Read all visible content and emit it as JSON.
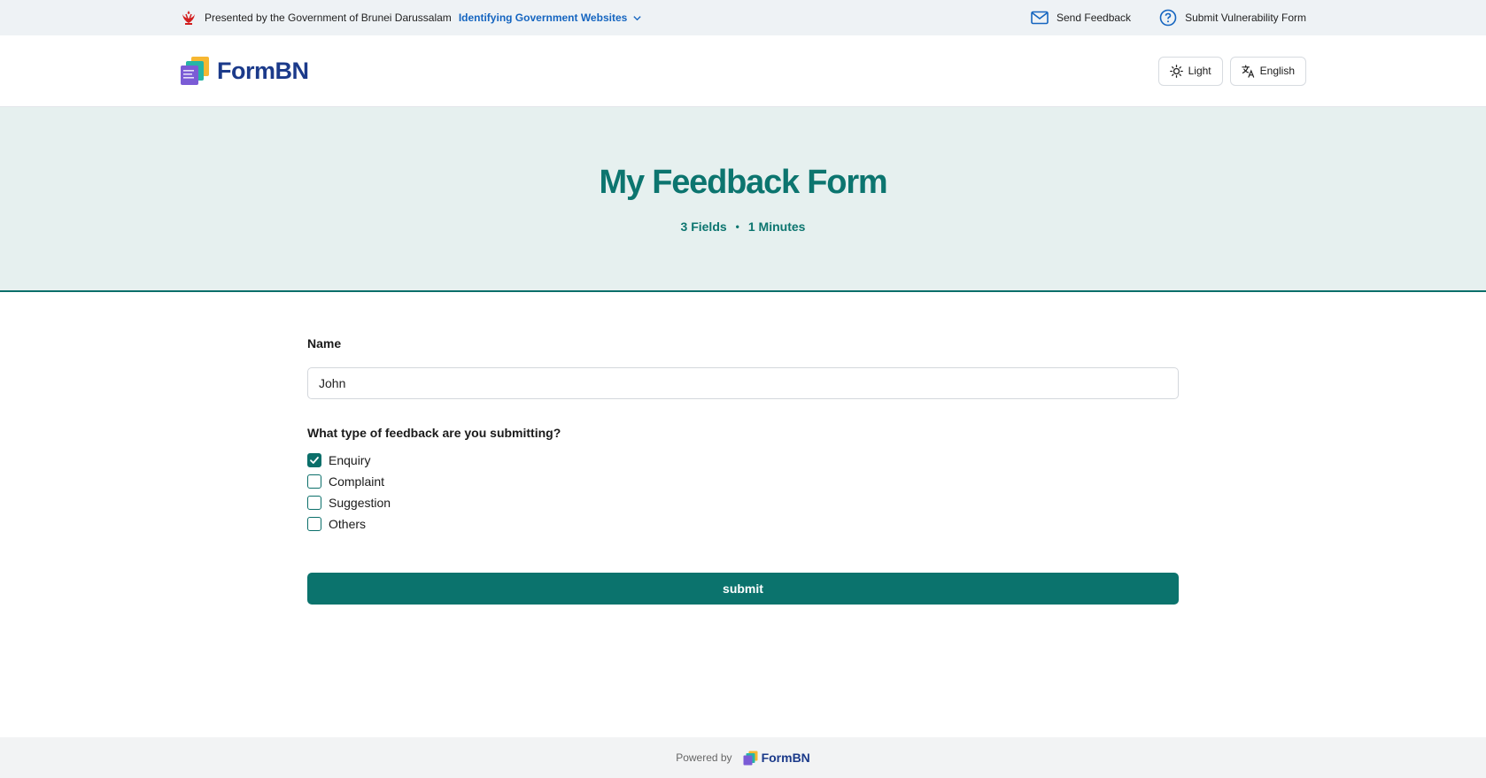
{
  "govbar": {
    "presented_text": "Presented by the Government of Brunei Darussalam",
    "identify_link": "Identifying Government Websites",
    "send_feedback": "Send Feedback",
    "submit_vulnerability": "Submit Vulnerability Form"
  },
  "header": {
    "brand": "FormBN",
    "theme_button": "Light",
    "language_button": "English"
  },
  "hero": {
    "title": "My Feedback Form",
    "fields": "3 Fields",
    "separator": "•",
    "minutes": "1 Minutes"
  },
  "form": {
    "name_label": "Name",
    "name_value": "John",
    "question_label": "What type of feedback are you submitting?",
    "options": [
      {
        "label": "Enquiry",
        "checked": true
      },
      {
        "label": "Complaint",
        "checked": false
      },
      {
        "label": "Suggestion",
        "checked": false
      },
      {
        "label": "Others",
        "checked": false
      }
    ],
    "submit_label": "submit"
  },
  "footer": {
    "powered_by": "Powered by",
    "brand": "FormBN"
  },
  "colors": {
    "accent": "#0b736d",
    "hero_bg": "#e6f0ef",
    "brand_text": "#1b3a8a",
    "link_blue": "#1565c0"
  },
  "icons": {
    "crest": "brunei-crest-icon",
    "gov_chevron": "chevron-down-icon",
    "mail": "mail-icon",
    "help": "question-circle-icon",
    "theme": "sun-icon",
    "language": "translate-icon",
    "check": "check-icon"
  }
}
